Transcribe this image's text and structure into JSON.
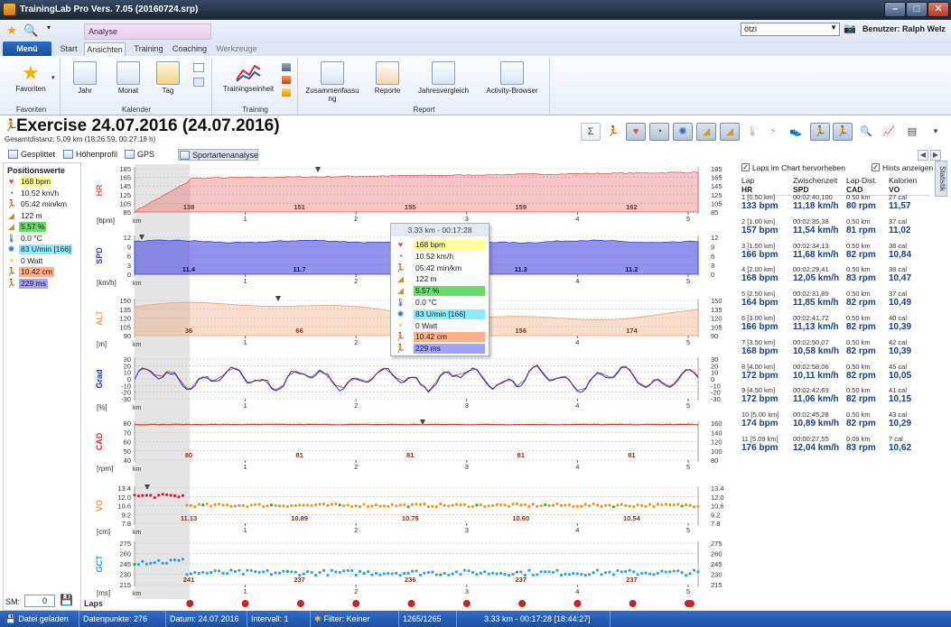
{
  "window": {
    "title": "TrainingLab Pro Vers. 7.05 (20160724.srp)"
  },
  "colors": {
    "hr": "#e85a5a",
    "spd": "#3a3ae0",
    "alt": "#f0a070",
    "cad": "#e03030",
    "vo": "#e0a020",
    "gct": "#30a0e0",
    "hl_yellow": "#ffff99",
    "hl_green": "#66dd66",
    "hl_cyan": "#88eeff",
    "hl_salmon": "#ffb08a",
    "hl_violet": "#a0a0ff",
    "status_bg": "#1d4fa0"
  },
  "ribbon": {
    "context_tab": "Analyse",
    "menu": "Menü",
    "tabs": [
      "Start",
      "Ansichten",
      "Training",
      "Coaching",
      "Werkzeuge"
    ],
    "active_tab": "Ansichten",
    "groups": {
      "favoriten": {
        "label": "Favoriten",
        "button": "Favoriten"
      },
      "kalender": {
        "label": "Kalender",
        "buttons": [
          "Jahr",
          "Monat",
          "Tag"
        ]
      },
      "training": {
        "label": "Training",
        "buttons": [
          "Trainingseinheit"
        ]
      },
      "report": {
        "label": "Report",
        "buttons": [
          "Zusammenfassu ng",
          "Reporte",
          "Jahresvergleich",
          "Activity-Browser"
        ]
      }
    }
  },
  "user": {
    "combo_value": "ötzi",
    "label": "Benutzer: Ralph Welz"
  },
  "exercise": {
    "title": "Exercise 24.07.2016 (24.07.2016)",
    "subtitle": "Gesamtdistanz: 5.09 km (18:26:59, 00:27:18 h)"
  },
  "subtabs": [
    "Gesplittet",
    "Höhenprofil",
    "GPS Karte",
    "Sportartenanalyse"
  ],
  "position_values": {
    "title": "Positionswerte",
    "items": [
      {
        "icon": "heart-icon",
        "text": "168 bpm",
        "hl": "#ffff99"
      },
      {
        "icon": "speedometer-icon",
        "text": "10.52 km/h",
        "hl": ""
      },
      {
        "icon": "runner-icon",
        "text": "05:42 min/km",
        "hl": ""
      },
      {
        "icon": "mountain-icon",
        "text": "122 m",
        "hl": ""
      },
      {
        "icon": "slope-icon",
        "text": "5.57 %",
        "hl": "#66dd66"
      },
      {
        "icon": "thermometer-icon",
        "text": "0.0 °C",
        "hl": ""
      },
      {
        "icon": "cadence-icon",
        "text": "83 U/min [166]",
        "hl": "#88eeff"
      },
      {
        "icon": "lightning-icon",
        "text": "0 Watt",
        "hl": ""
      },
      {
        "icon": "stride-icon",
        "text": "10.42 cm",
        "hl": "#ffb08a"
      },
      {
        "icon": "contact-icon",
        "text": "229 ms",
        "hl": "#a0a0ff"
      }
    ]
  },
  "sm": {
    "label": "SM:",
    "value": "0"
  },
  "tooltip": {
    "header": "3.33 km - 00:17:28"
  },
  "chart_data": {
    "type": "line",
    "x_unit": "km",
    "x_ticks": [
      "1",
      "2",
      "3",
      "4",
      "5"
    ],
    "x_range": [
      0,
      5.09
    ],
    "panels": [
      {
        "name": "HR",
        "unit": "[bpm]",
        "left_ticks": [
          "185",
          "165",
          "145",
          "125",
          "105",
          "85"
        ],
        "right_ticks": [
          "185",
          "165",
          "145",
          "125",
          "105",
          "85"
        ],
        "ylim": [
          85,
          185
        ],
        "lap_labels": [
          "138",
          "151",
          "155",
          "159",
          "162"
        ]
      },
      {
        "name": "SPD",
        "unit": "[km/h]",
        "left_ticks": [
          "12",
          "9",
          "6",
          "3",
          "0"
        ],
        "right_ticks": [
          "12",
          "9",
          "6",
          "3",
          "0"
        ],
        "ylim": [
          0,
          13
        ],
        "lap_labels": [
          "11.4",
          "11.7",
          "",
          "11.3",
          "11.2"
        ]
      },
      {
        "name": "ALT",
        "unit": "[m]",
        "left_ticks": [
          "150",
          "135",
          "120",
          "105",
          "90"
        ],
        "right_ticks": [
          "150",
          "135",
          "120",
          "105",
          "90"
        ],
        "ylim": [
          90,
          155
        ],
        "lap_labels": [
          "36",
          "66",
          "",
          "156",
          "174"
        ]
      },
      {
        "name": "Grad",
        "unit": "[%]",
        "left_ticks": [
          "30",
          "20",
          "10",
          "0",
          "-10",
          "-20",
          "-30"
        ],
        "right_ticks": [
          "30",
          "20",
          "10",
          "0",
          "-10",
          "-20",
          "-30"
        ],
        "ylim": [
          -30,
          30
        ]
      },
      {
        "name": "CAD",
        "unit": "[rpm]",
        "left_ticks": [
          "80",
          "70",
          "60",
          "50",
          "40"
        ],
        "right_ticks": [
          "160",
          "140",
          "120",
          "100",
          "80"
        ],
        "ylim": [
          40,
          82
        ],
        "lap_labels": [
          "80",
          "81",
          "81",
          "81",
          "81"
        ]
      },
      {
        "name": "VO",
        "unit": "[cm]",
        "left_ticks": [
          "13.4",
          "12.0",
          "10.6",
          "9.2",
          "7.8"
        ],
        "right_ticks": [
          "13.4",
          "12.0",
          "10.6",
          "9.2",
          "7.8"
        ],
        "ylim": [
          7.8,
          13.6
        ],
        "lap_labels": [
          "11.13",
          "10.89",
          "10.75",
          "10.60",
          "10.54"
        ]
      },
      {
        "name": "GCT",
        "unit": "[ms]",
        "left_ticks": [
          "275",
          "260",
          "245",
          "230",
          "215"
        ],
        "right_ticks": [
          "275",
          "260",
          "245",
          "230",
          "215"
        ],
        "ylim": [
          215,
          278
        ],
        "lap_labels": [
          "241",
          "237",
          "236",
          "237",
          "237"
        ]
      }
    ],
    "laps_label": "Laps"
  },
  "right": {
    "checkbox_laps": "Laps im Chart hervorheben",
    "checkbox_hints": "Hints anzeigen",
    "side_tab": "Statistik",
    "headers": [
      {
        "top": "Lap",
        "bottom": "HR"
      },
      {
        "top": "Zwischenzeit",
        "bottom": "SPD"
      },
      {
        "top": "Lap-Dist.",
        "bottom": "CAD"
      },
      {
        "top": "Kalorien",
        "bottom": "VO"
      }
    ],
    "laps": [
      {
        "lap": "1 [0.50 km]",
        "time": "00:02:40,100",
        "dist": "0.50 km",
        "kcal": "27 cal",
        "hr": "133 bpm",
        "spd": "11,18 km/h",
        "cad": "80 rpm",
        "vo": "11,57"
      },
      {
        "lap": "2 [1.00 km]",
        "time": "00:02:35,38",
        "dist": "0.50 km",
        "kcal": "37 cal",
        "hr": "157 bpm",
        "spd": "11,54 km/h",
        "cad": "81 rpm",
        "vo": "11,02"
      },
      {
        "lap": "3 [1.50 km]",
        "time": "00:02:34,13",
        "dist": "0.50 km",
        "kcal": "38 cal",
        "hr": "166 bpm",
        "spd": "11,68 km/h",
        "cad": "82 rpm",
        "vo": "10,84"
      },
      {
        "lap": "4 [2.00 km]",
        "time": "00:02:29,41",
        "dist": "0.50 km",
        "kcal": "38 cal",
        "hr": "168 bpm",
        "spd": "12,05 km/h",
        "cad": "83 rpm",
        "vo": "10,47"
      },
      {
        "lap": "5 [2.50 km]",
        "time": "00:02:31,89",
        "dist": "0.50 km",
        "kcal": "37 cal",
        "hr": "164 bpm",
        "spd": "11,85 km/h",
        "cad": "82 rpm",
        "vo": "10,49"
      },
      {
        "lap": "6 [3.00 km]",
        "time": "00:02:41,72",
        "dist": "0.50 km",
        "kcal": "40 cal",
        "hr": "166 bpm",
        "spd": "11,13 km/h",
        "cad": "82 rpm",
        "vo": "10,39"
      },
      {
        "lap": "7 [3.50 km]",
        "time": "00:02:50,07",
        "dist": "0.50 km",
        "kcal": "42 cal",
        "hr": "168 bpm",
        "spd": "10,58 km/h",
        "cad": "82 rpm",
        "vo": "10,39"
      },
      {
        "lap": "8 [4.00 km]",
        "time": "00:02:58,06",
        "dist": "0.50 km",
        "kcal": "45 cal",
        "hr": "172 bpm",
        "spd": "10,11 km/h",
        "cad": "82 rpm",
        "vo": "10,05"
      },
      {
        "lap": "9 [4.50 km]",
        "time": "00:02:42,69",
        "dist": "0.50 km",
        "kcal": "41 cal",
        "hr": "172 bpm",
        "spd": "11,06 km/h",
        "cad": "82 rpm",
        "vo": "10,15"
      },
      {
        "lap": "10 [5.00 km]",
        "time": "00:02:45,28",
        "dist": "0.50 km",
        "kcal": "43 cal",
        "hr": "174 bpm",
        "spd": "10,89 km/h",
        "cad": "82 rpm",
        "vo": "10,29"
      },
      {
        "lap": "11 [5.09 km]",
        "time": "00:00:27,55",
        "dist": "0.09 km",
        "kcal": "7 cal",
        "hr": "176 bpm",
        "spd": "12,04 km/h",
        "cad": "83 rpm",
        "vo": "10,62"
      }
    ]
  },
  "status": {
    "file": "Datei geladen",
    "points": "Datenpunkte: 276",
    "date": "Datum: 24.07.2016",
    "interval": "Intervall: 1",
    "filter": "Filter: Keiner",
    "range": "1265/1265",
    "position": "3.33 km - 00:17:28 [18:44:27]"
  }
}
